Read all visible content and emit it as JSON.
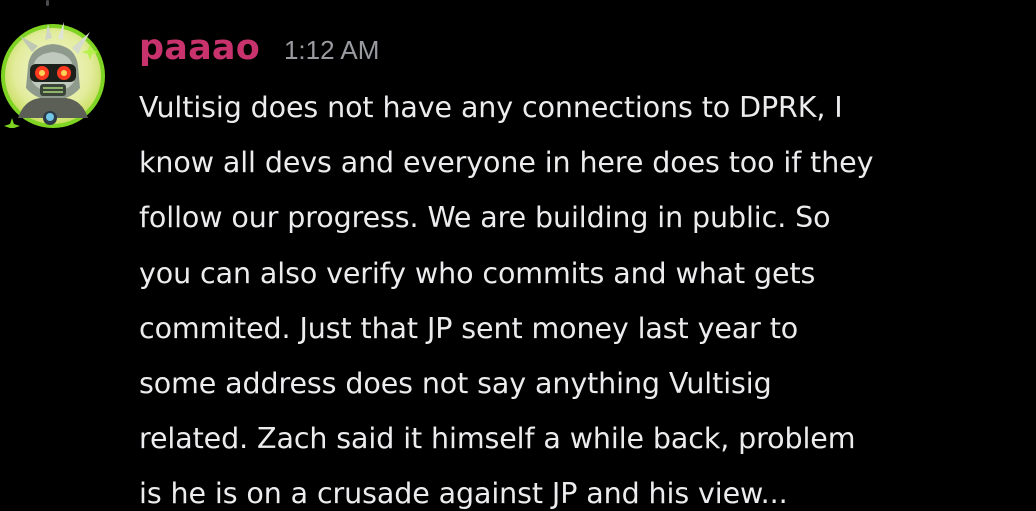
{
  "message": {
    "username": "paaao",
    "timestamp": "1:12 AM",
    "avatar_icon": "robot-avatar-icon",
    "username_color": "#c9336d",
    "text": "Vultisig does not have any connections to DPRK, I\nknow all devs and everyone in here does too if they\nfollow our progress. We are building in public. So\nyou can also verify who commits and what gets\ncommited. Just that JP sent money last year to\nsome address does not say anything Vultisig\nrelated. Zach said it himself a while back, problem\nis he is on a crusade against JP and his view..."
  }
}
